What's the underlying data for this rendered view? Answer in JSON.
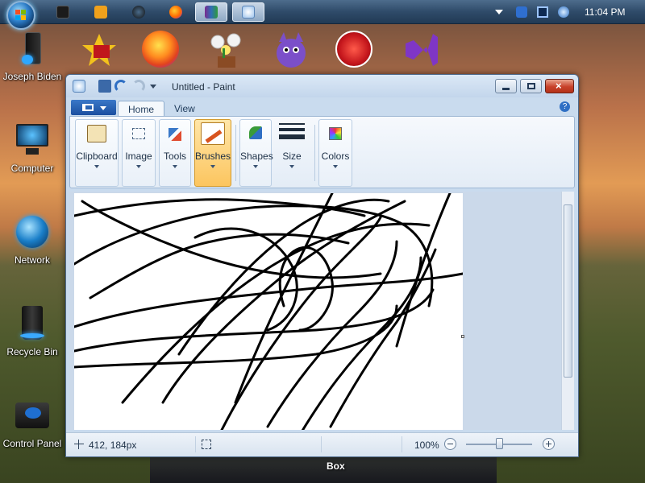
{
  "taskbar": {
    "clock": "11:04 PM",
    "pinned": [
      "explorer",
      "media-player",
      "camera",
      "firefox",
      "winrar",
      "paint"
    ]
  },
  "desktop": {
    "icons": [
      {
        "label": "Joseph Biden",
        "icon": "pc-tower-icon"
      },
      {
        "label": "Computer",
        "icon": "monitor-icon"
      },
      {
        "label": "Network",
        "icon": "network-globe-icon"
      },
      {
        "label": "Recycle Bin",
        "icon": "recycle-bin-icon"
      },
      {
        "label": "Control Panel",
        "icon": "control-panel-icon"
      }
    ],
    "dock": [
      "flash-app-icon",
      "firefox-icon",
      "flower-pot-icon",
      "purple-monster-icon",
      "dragon-icon",
      "visual-studio-icon"
    ],
    "dock_peek_text": "Box"
  },
  "paint": {
    "title": "Untitled - Paint",
    "tabs": [
      "Home",
      "View"
    ],
    "groups": [
      {
        "label": "Clipboard",
        "icon": "clipboard-icon"
      },
      {
        "label": "Image",
        "icon": "image-select-icon"
      },
      {
        "label": "Tools",
        "icon": "tools-icon"
      },
      {
        "label": "Brushes",
        "icon": "brush-icon"
      },
      {
        "label": "Shapes",
        "icon": "shapes-icon"
      },
      {
        "label": "Size",
        "icon": "size-lines-icon"
      },
      {
        "label": "Colors",
        "icon": "colors-palette-icon"
      }
    ],
    "status": {
      "cursor_position": "412, 184px",
      "zoom": "100%"
    }
  },
  "colors": {
    "accent": "#3a78c8",
    "selected_group": "#fcc55f",
    "close_button": "#c8412a"
  }
}
